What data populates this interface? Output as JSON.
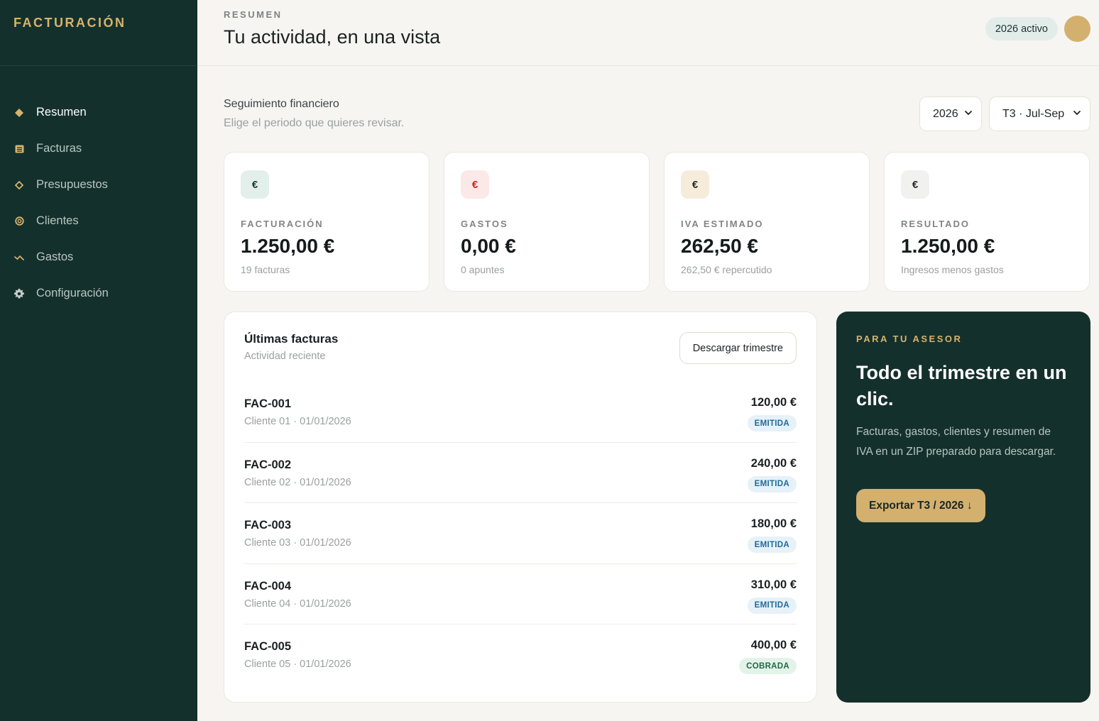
{
  "brand": "FACTURACIÓN",
  "sidebar": {
    "items": [
      {
        "label": "Resumen",
        "icon": "diamond-filled-icon"
      },
      {
        "label": "Facturas",
        "icon": "document-icon"
      },
      {
        "label": "Presupuestos",
        "icon": "diamond-outline-icon"
      },
      {
        "label": "Clientes",
        "icon": "target-icon"
      },
      {
        "label": "Gastos",
        "icon": "trend-icon"
      },
      {
        "label": "Configuración",
        "icon": "gear-icon"
      }
    ],
    "active": "Resumen"
  },
  "header": {
    "eyebrow": "RESUMEN",
    "title": "Tu actividad, en una vista",
    "year_chip": "2026 activo"
  },
  "period": {
    "title": "Seguimiento financiero",
    "subtitle": "Elige el periodo que quieres revisar.",
    "year_select": "2026",
    "quarter_select": "T3 · Jul-Sep"
  },
  "stats": [
    {
      "label": "FACTURACIÓN",
      "value": "1.250,00 €",
      "sub": "19 facturas",
      "icon": "€",
      "icon_bg": "#e3efea",
      "icon_color": "#1e3a35"
    },
    {
      "label": "GASTOS",
      "value": "0,00 €",
      "sub": "0 apuntes",
      "icon": "€",
      "icon_bg": "#fbe9e7",
      "icon_color": "#c62828"
    },
    {
      "label": "IVA ESTIMADO",
      "value": "262,50 €",
      "sub": "262,50 € repercutido",
      "icon": "€",
      "icon_bg": "#f6ecdc",
      "icon_color": "#2a2a2a"
    },
    {
      "label": "RESULTADO",
      "value": "1.250,00 €",
      "sub": "Ingresos menos gastos",
      "icon": "€",
      "icon_bg": "#f1f1ef",
      "icon_color": "#2a2a2a"
    }
  ],
  "invoices": {
    "title": "Últimas facturas",
    "subtitle": "Actividad reciente",
    "download_label": "Descargar trimestre",
    "rows": [
      {
        "id": "FAC-001",
        "meta": "Cliente 01 · 01/01/2026",
        "amount": "120,00 €",
        "status": "EMITIDA"
      },
      {
        "id": "FAC-002",
        "meta": "Cliente 02 · 01/01/2026",
        "amount": "240,00 €",
        "status": "EMITIDA"
      },
      {
        "id": "FAC-003",
        "meta": "Cliente 03 · 01/01/2026",
        "amount": "180,00 €",
        "status": "EMITIDA"
      },
      {
        "id": "FAC-004",
        "meta": "Cliente 04 · 01/01/2026",
        "amount": "310,00 €",
        "status": "EMITIDA"
      },
      {
        "id": "FAC-005",
        "meta": "Cliente 05 · 01/01/2026",
        "amount": "400,00 €",
        "status": "COBRADA"
      }
    ]
  },
  "advisor": {
    "eyebrow": "PARA TU ASESOR",
    "title": "Todo el trimestre en un clic.",
    "text": "Facturas, gastos, clientes y resumen de IVA en un ZIP preparado para descargar.",
    "button": "Exportar T3 / 2026 ↓"
  },
  "colors": {
    "sidebar": "#14302c",
    "accent_gold": "#d4b06e",
    "badge_emitida_bg": "#e6f1f8",
    "badge_emitida_fg": "#1f6a9a",
    "badge_cobrada_bg": "#e4f3ea",
    "badge_cobrada_fg": "#1d6b45"
  }
}
